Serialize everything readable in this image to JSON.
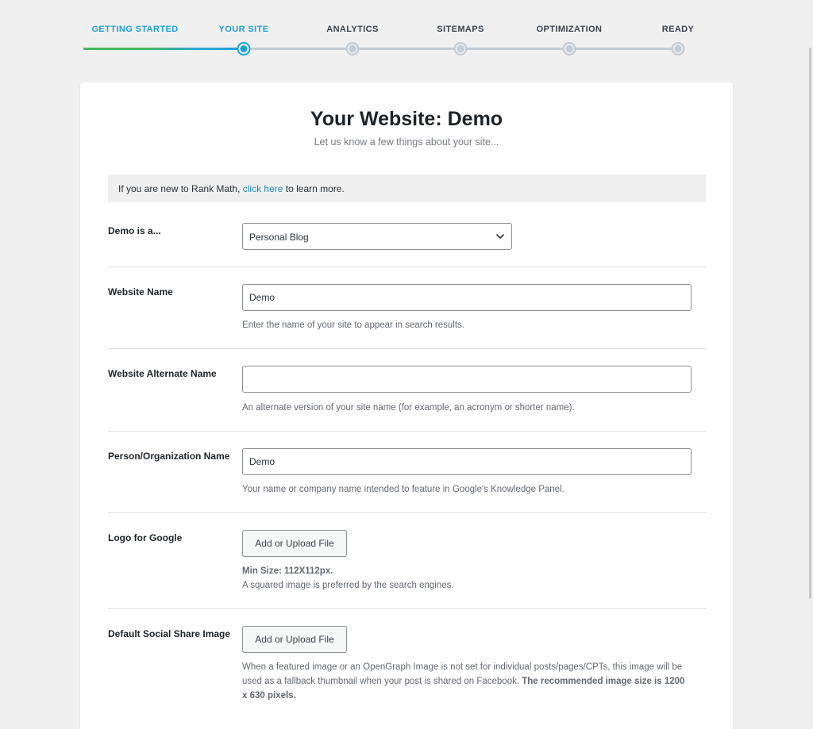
{
  "steps": [
    {
      "label": "GETTING STARTED"
    },
    {
      "label": "YOUR SITE"
    },
    {
      "label": "ANALYTICS"
    },
    {
      "label": "SITEMAPS"
    },
    {
      "label": "OPTIMIZATION"
    },
    {
      "label": "READY"
    }
  ],
  "current_step": "YOUR SITE",
  "header": {
    "title": "Your Website: Demo",
    "subtitle": "Let us know a few things about your site..."
  },
  "notice": {
    "prefix": "If you are new to Rank Math, ",
    "link": "click here",
    "suffix": " to learn more."
  },
  "fields": {
    "site_type": {
      "label": "Demo is a...",
      "value": "Personal Blog"
    },
    "website_name": {
      "label": "Website Name",
      "value": "Demo",
      "description": "Enter the name of your site to appear in search results."
    },
    "alternate_name": {
      "label": "Website Alternate Name",
      "value": "",
      "description": "An alternate version of your site name (for example, an acronym or shorter name)."
    },
    "org_name": {
      "label": "Person/Organization Name",
      "value": "Demo",
      "description": "Your name or company name intended to feature in Google's Knowledge Panel."
    },
    "logo": {
      "label": "Logo for Google",
      "button": "Add or Upload File",
      "min_size": "Min Size: 112X112px.",
      "description": "A squared image is preferred by the search engines."
    },
    "social_image": {
      "label": "Default Social Share Image",
      "button": "Add or Upload File",
      "description": "When a featured image or an OpenGraph Image is not set for individual posts/pages/CPTs, this image will be used as a fallback thumbnail when your post is shared on Facebook. ",
      "recommendation": "The recommended image size is 1200 x 630 pixels."
    }
  },
  "colors": {
    "accent": "#1e9fd8",
    "done_start": "#48b85c",
    "track": "#c3cbd3"
  }
}
